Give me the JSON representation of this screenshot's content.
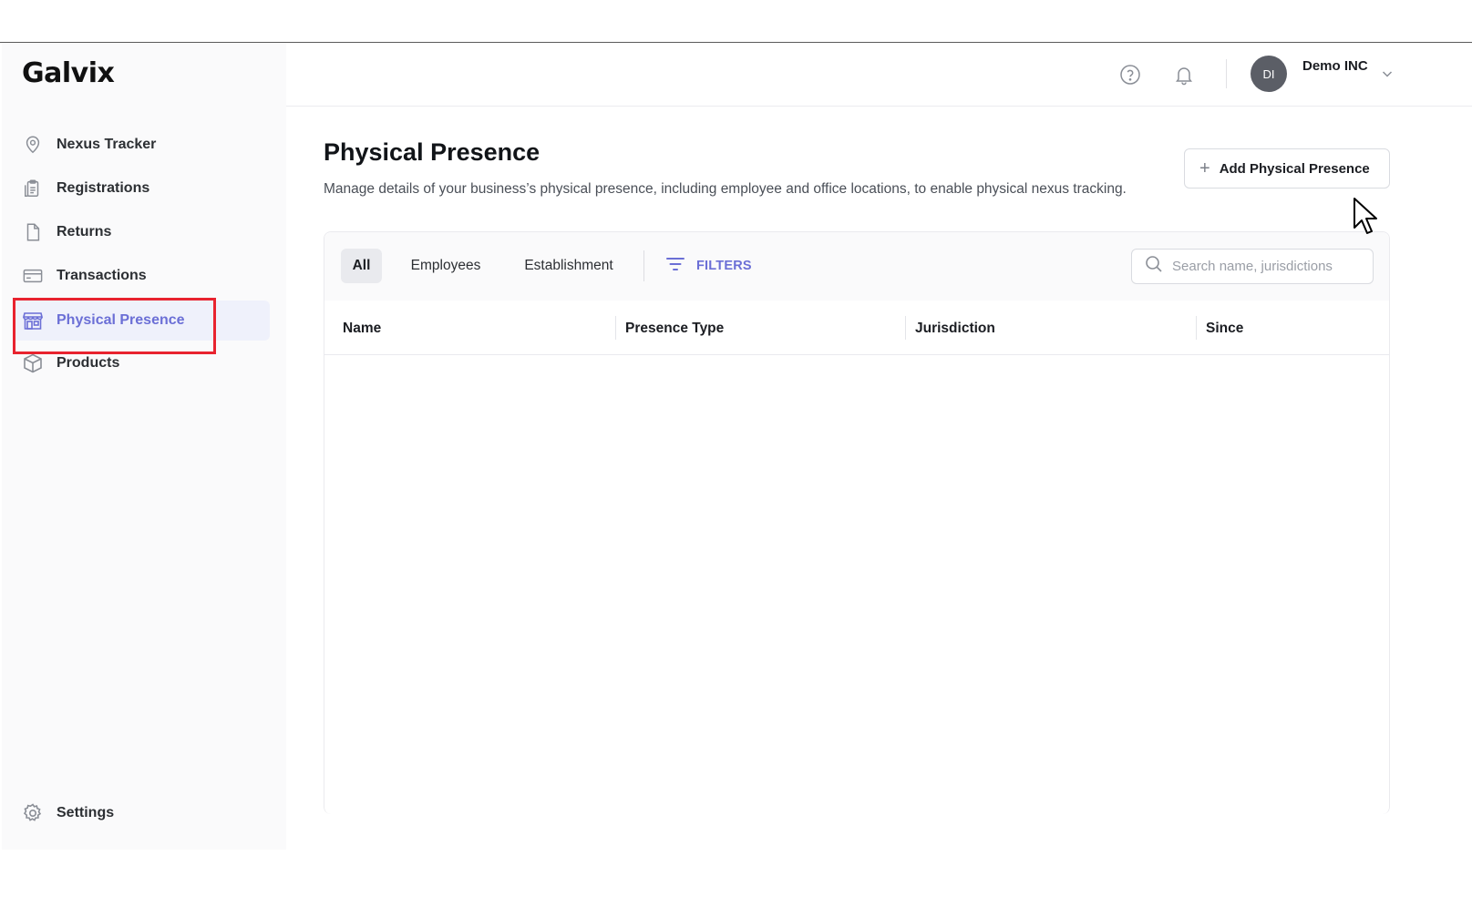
{
  "app": {
    "logo": "Galvix"
  },
  "sidebar": {
    "items": [
      {
        "label": "Nexus Tracker",
        "icon": "location-pin-icon"
      },
      {
        "label": "Registrations",
        "icon": "clipboard-icon"
      },
      {
        "label": "Returns",
        "icon": "document-icon"
      },
      {
        "label": "Transactions",
        "icon": "credit-card-icon"
      },
      {
        "label": "Physical Presence",
        "icon": "storefront-icon",
        "active": true
      },
      {
        "label": "Products",
        "icon": "box-icon"
      }
    ],
    "settings": {
      "label": "Settings",
      "icon": "gear-icon"
    }
  },
  "header": {
    "avatar_initials": "DI",
    "org_name": "Demo INC"
  },
  "main": {
    "title": "Physical Presence",
    "description": "Manage details of your business’s physical presence, including employee and office locations, to enable physical nexus tracking.",
    "add_button": {
      "plus": "+",
      "label": "Add Physical Presence"
    },
    "tabs": [
      {
        "label": "All",
        "active": true
      },
      {
        "label": "Employees"
      },
      {
        "label": "Establishment"
      }
    ],
    "filters_label": "FILTERS",
    "search": {
      "placeholder": "Search name, jurisdictions",
      "value": ""
    },
    "table": {
      "columns": [
        "Name",
        "Presence Type",
        "Jurisdiction",
        "Since"
      ],
      "rows": []
    }
  },
  "colors": {
    "accent": "#6b6fd6",
    "active_bg": "#eff1fb",
    "highlight": "#e8232f"
  }
}
